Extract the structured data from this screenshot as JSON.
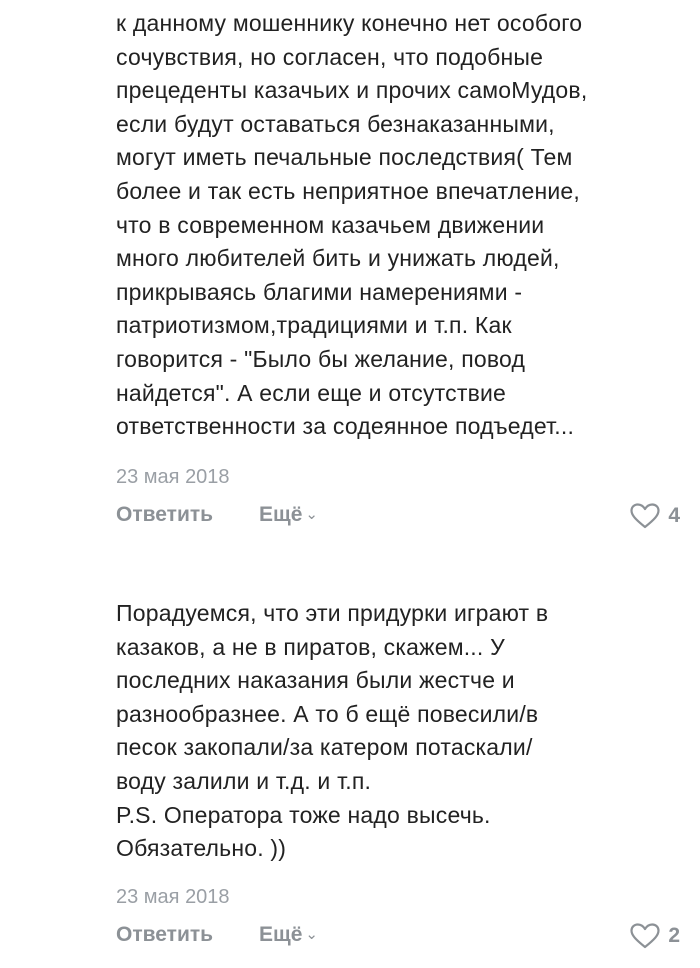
{
  "comments": [
    {
      "lines": [
        "к данному мошеннику конечно нет особого",
        "сочувствия, но согласен, что подобные",
        "прецеденты казачьих и прочих самоМудов,",
        "если будут оставаться безнаказанными,",
        "могут иметь печальные последствия( Тем",
        "более и так есть неприятное впечатление,",
        "что в современном казачьем движении",
        "много любителей бить и унижать людей,",
        "прикрываясь благими намерениями -",
        "патриотизмом,традициями и т.п. Как",
        "говорится - \"Было бы желание, повод",
        "найдется\". А если еще и отсутствие",
        "ответственности за содеянное подъедет..."
      ],
      "date": "23 мая 2018",
      "reply_label": "Ответить",
      "more_label": "Ещё",
      "likes": "4"
    },
    {
      "lines": [
        "Порадуемся, что эти придурки играют в",
        "казаков, а не в пиратов, скажем... У",
        "последних наказания были жестче и",
        "разнообразнее. А то б ещё повесили/в",
        "песок закопали/за катером потаскали/",
        "воду залили и т.д. и т.п.",
        "P.S. Оператора тоже надо высечь.",
        "Обязательно. ))"
      ],
      "date": "23 мая 2018",
      "reply_label": "Ответить",
      "more_label": "Ещё",
      "likes": "2"
    }
  ],
  "icons": {
    "more_chevron": "chevron-down-icon",
    "like": "heart-icon"
  },
  "colors": {
    "text": "#222222",
    "meta": "#9a9fa5",
    "action": "#8c9196",
    "background": "#ffffff"
  }
}
